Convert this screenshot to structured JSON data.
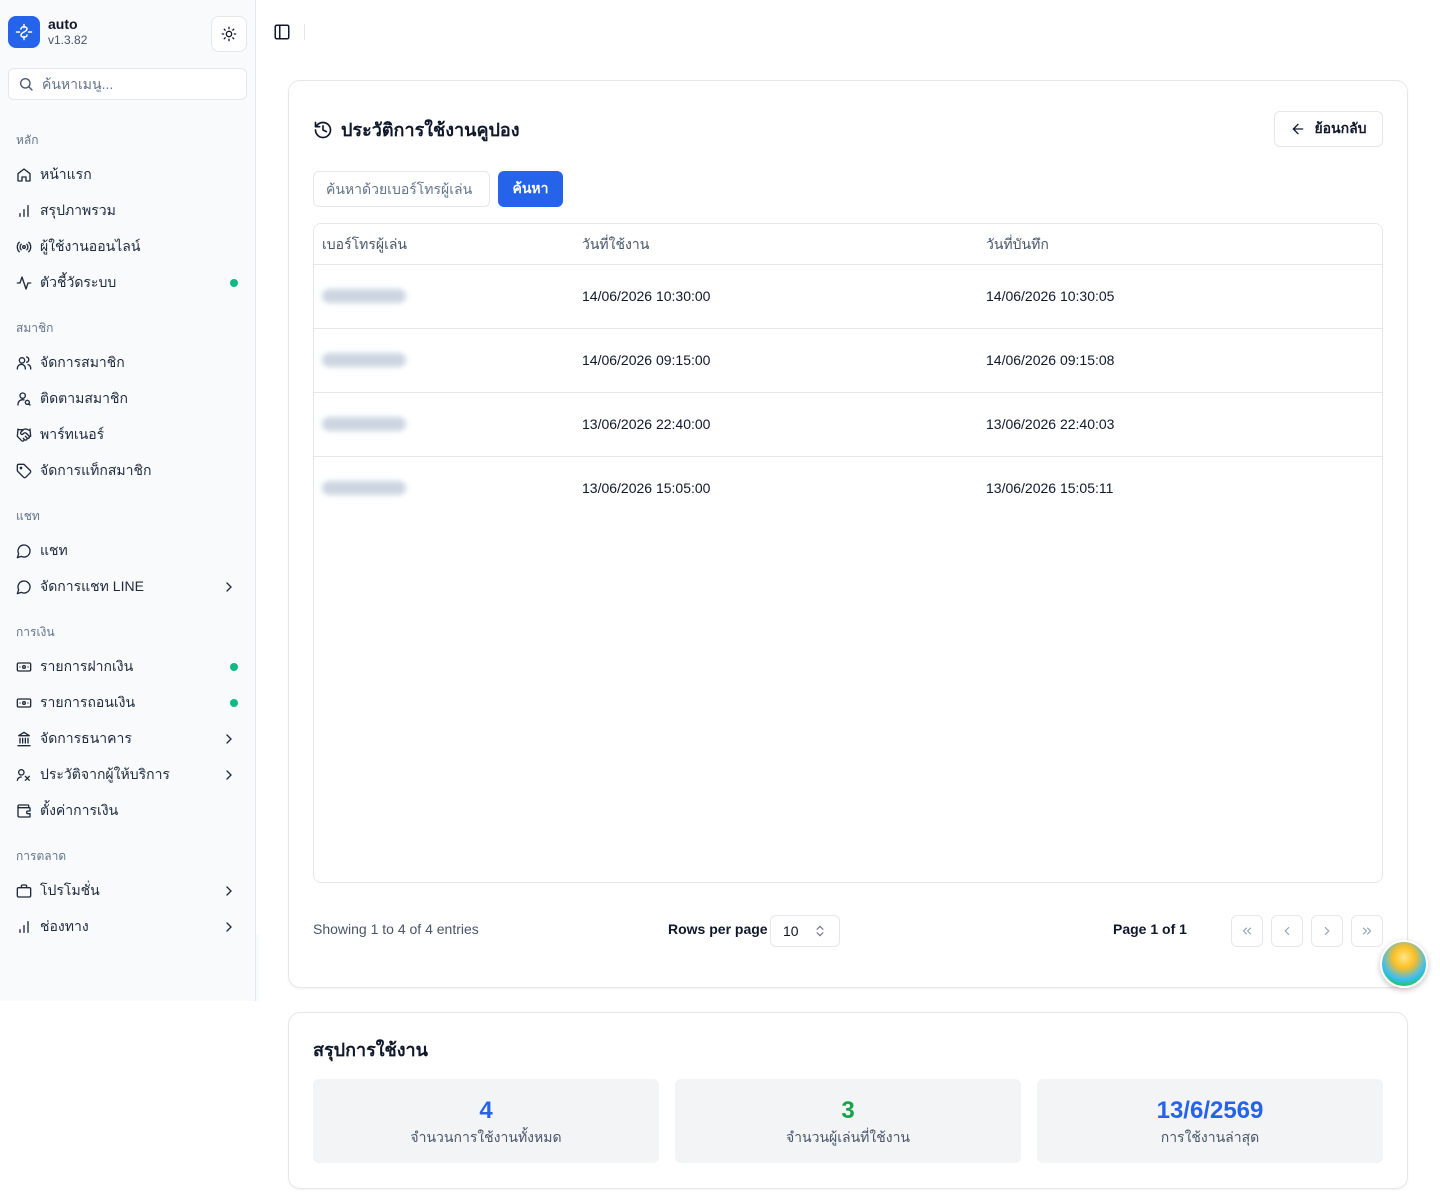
{
  "app": {
    "name": "auto",
    "version": "v1.3.82"
  },
  "sidebar": {
    "search_placeholder": "ค้นหาเมนู...",
    "groups": [
      {
        "label": "หลัก",
        "items": [
          {
            "label": "หน้าแรก",
            "icon": "home-icon"
          },
          {
            "label": "สรุปภาพรวม",
            "icon": "bar-chart-icon"
          },
          {
            "label": "ผู้ใช้งานออนไลน์",
            "icon": "radio-icon"
          },
          {
            "label": "ตัวชี้วัดระบบ",
            "icon": "activity-icon",
            "status_dot": true
          }
        ]
      },
      {
        "label": "สมาชิก",
        "items": [
          {
            "label": "จัดการสมาชิก",
            "icon": "users-icon"
          },
          {
            "label": "ติดตามสมาชิก",
            "icon": "user-search-icon"
          },
          {
            "label": "พาร์ทเนอร์",
            "icon": "handshake-icon"
          },
          {
            "label": "จัดการแท็กสมาชิก",
            "icon": "tag-icon"
          }
        ]
      },
      {
        "label": "แชท",
        "items": [
          {
            "label": "แชท",
            "icon": "message-circle-icon"
          },
          {
            "label": "จัดการแชท LINE",
            "icon": "message-circle-icon",
            "has_submenu": true
          }
        ]
      },
      {
        "label": "การเงิน",
        "items": [
          {
            "label": "รายการฝากเงิน",
            "icon": "deposit-icon",
            "status_dot": true
          },
          {
            "label": "รายการถอนเงิน",
            "icon": "withdraw-icon",
            "status_dot": true
          },
          {
            "label": "จัดการธนาคาร",
            "icon": "bank-icon",
            "has_submenu": true
          },
          {
            "label": "ประวัติจากผู้ให้บริการ",
            "icon": "provider-history-icon",
            "has_submenu": true
          },
          {
            "label": "ตั้งค่าการเงิน",
            "icon": "wallet-icon"
          }
        ]
      },
      {
        "label": "การตลาด",
        "items": [
          {
            "label": "โปรโมชั่น",
            "icon": "briefcase-icon",
            "has_submenu": true
          },
          {
            "label": "ช่องทาง",
            "icon": "bar-chart-icon",
            "has_submenu": true
          }
        ]
      }
    ]
  },
  "main": {
    "title": "ประวัติการใช้งานคูปอง",
    "back_label": "ย้อนกลับ",
    "search_placeholder": "ค้นหาด้วยเบอร์โทรผู้เล่น",
    "search_button": "ค้นหา",
    "table": {
      "columns": [
        "เบอร์โทรผู้เล่น",
        "วันที่ใช้งาน",
        "วันที่บันทึก"
      ],
      "rows": [
        {
          "phone_hidden": true,
          "used_at": "14/06/2026 10:30:00",
          "recorded_at": "14/06/2026 10:30:05"
        },
        {
          "phone_hidden": true,
          "used_at": "14/06/2026 09:15:00",
          "recorded_at": "14/06/2026 09:15:08"
        },
        {
          "phone_hidden": true,
          "used_at": "13/06/2026 22:40:00",
          "recorded_at": "13/06/2026 22:40:03"
        },
        {
          "phone_hidden": true,
          "used_at": "13/06/2026 15:05:00",
          "recorded_at": "13/06/2026 15:05:11"
        }
      ]
    },
    "pagination": {
      "showing": "Showing 1 to 4 of 4 entries",
      "rows_per_page_label": "Rows per page",
      "rows_per_page": "10",
      "page_label": "Page 1 of 1"
    }
  },
  "summary": {
    "title": "สรุปการใช้งาน",
    "stats": [
      {
        "value": "4",
        "caption": "จำนวนการใช้งานทั้งหมด",
        "color": "#2563eb"
      },
      {
        "value": "3",
        "caption": "จำนวนผู้เล่นที่ใช้งาน",
        "color": "#16a34a"
      },
      {
        "value": "13/6/2569",
        "caption": "การใช้งานล่าสุด",
        "color": "#2563eb"
      }
    ]
  },
  "colors": {
    "primary": "#2563eb",
    "success": "#10b981"
  }
}
